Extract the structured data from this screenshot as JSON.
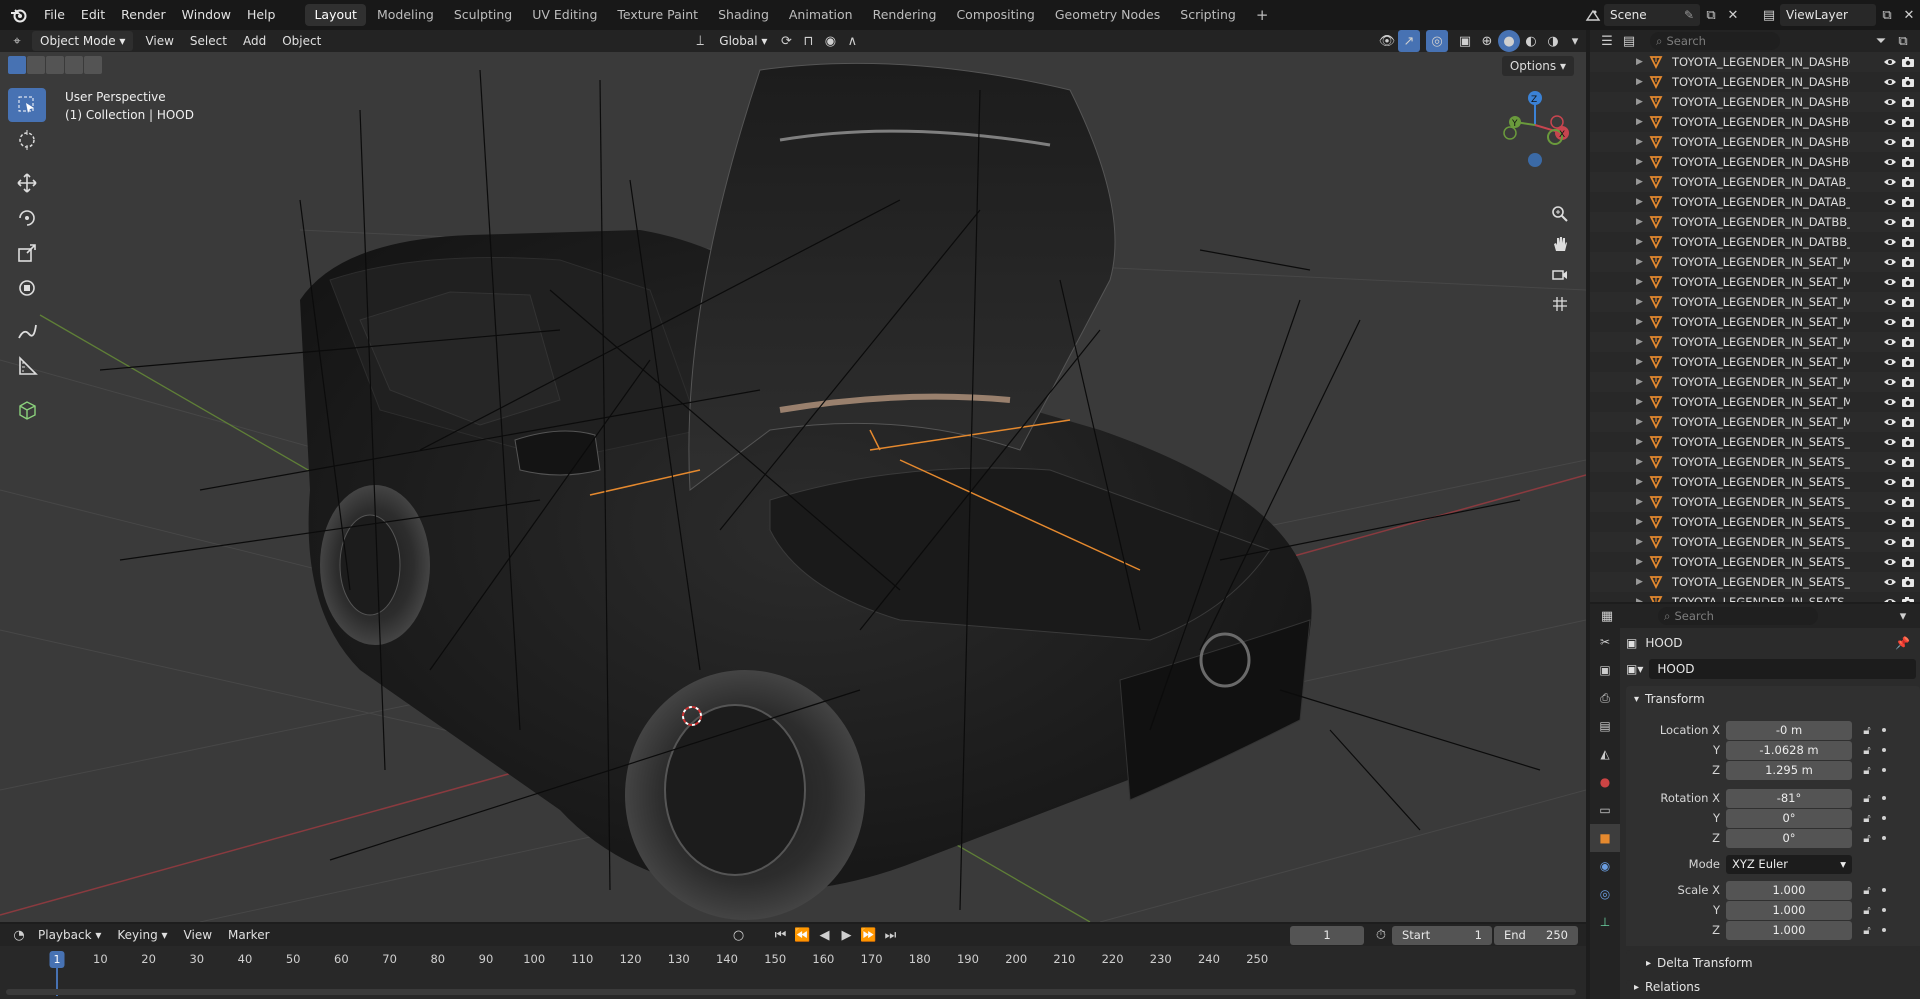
{
  "menu": [
    "File",
    "Edit",
    "Render",
    "Window",
    "Help"
  ],
  "workspaces": [
    "Layout",
    "Modeling",
    "Sculpting",
    "UV Editing",
    "Texture Paint",
    "Shading",
    "Animation",
    "Rendering",
    "Compositing",
    "Geometry Nodes",
    "Scripting"
  ],
  "active_workspace": "Layout",
  "scene_name": "Scene",
  "view_layer": "ViewLayer",
  "viewport": {
    "mode": "Object Mode",
    "menus": [
      "View",
      "Select",
      "Add",
      "Object"
    ],
    "orientation": "Global",
    "options_label": "Options",
    "info_line1": "User Perspective",
    "info_line2": "(1) Collection | HOOD"
  },
  "outliner": {
    "search_placeholder": "Search",
    "items": [
      "TOYOTA_LEGENDER_IN_DASHBO",
      "TOYOTA_LEGENDER_IN_DASHBO",
      "TOYOTA_LEGENDER_IN_DASHBO",
      "TOYOTA_LEGENDER_IN_DASHBO",
      "TOYOTA_LEGENDER_IN_DASHBO",
      "TOYOTA_LEGENDER_IN_DASHBO",
      "TOYOTA_LEGENDER_IN_DATAB_E",
      "TOYOTA_LEGENDER_IN_DATAB_E",
      "TOYOTA_LEGENDER_IN_DATBB_E",
      "TOYOTA_LEGENDER_IN_DATBB_E",
      "TOYOTA_LEGENDER_IN_SEAT_MI",
      "TOYOTA_LEGENDER_IN_SEAT_MI",
      "TOYOTA_LEGENDER_IN_SEAT_MI",
      "TOYOTA_LEGENDER_IN_SEAT_MI",
      "TOYOTA_LEGENDER_IN_SEAT_MI",
      "TOYOTA_LEGENDER_IN_SEAT_MI",
      "TOYOTA_LEGENDER_IN_SEAT_MI",
      "TOYOTA_LEGENDER_IN_SEAT_MI",
      "TOYOTA_LEGENDER_IN_SEAT_MI",
      "TOYOTA_LEGENDER_IN_SEATS_N",
      "TOYOTA_LEGENDER_IN_SEATS_N",
      "TOYOTA_LEGENDER_IN_SEATS_N",
      "TOYOTA_LEGENDER_IN_SEATS_N",
      "TOYOTA_LEGENDER_IN_SEATS_N",
      "TOYOTA_LEGENDER_IN_SEATS_N",
      "TOYOTA_LEGENDER_IN_SEATS_N",
      "TOYOTA_LEGENDER_IN_SEATS_N",
      "TOYOTA_LEGENDER_IN_SEATS_N"
    ]
  },
  "properties": {
    "search_placeholder": "Search",
    "object_name": "HOOD",
    "data_name": "HOOD",
    "transform_label": "Transform",
    "location": {
      "label": "Location X",
      "x": "-0 m",
      "y": "-1.0628 m",
      "z": "1.295 m"
    },
    "rotation": {
      "label": "Rotation X",
      "x": "-81°",
      "y": "0°",
      "z": "0°"
    },
    "mode_label": "Mode",
    "mode_value": "XYZ Euler",
    "scale": {
      "label": "Scale X",
      "x": "1.000",
      "y": "1.000",
      "z": "1.000"
    },
    "axis_y": "Y",
    "axis_z": "Z",
    "delta_transform": "Delta Transform",
    "relations": "Relations"
  },
  "timeline": {
    "menus": [
      "Playback",
      "Keying",
      "View",
      "Marker"
    ],
    "current_frame": "1",
    "start_label": "Start",
    "start_value": "1",
    "end_label": "End",
    "end_value": "250",
    "ticks": [
      "10",
      "20",
      "30",
      "40",
      "50",
      "60",
      "70",
      "80",
      "90",
      "100",
      "110",
      "120",
      "130",
      "140",
      "150",
      "160",
      "170",
      "180",
      "190",
      "200",
      "210",
      "220",
      "230",
      "240",
      "250"
    ]
  },
  "colors": {
    "accent": "#4772b3",
    "object_orange": "#e5892e",
    "axis_x_red": "#c7454f",
    "axis_y_green": "#6a9a3c",
    "axis_z_blue": "#3b82d6"
  }
}
